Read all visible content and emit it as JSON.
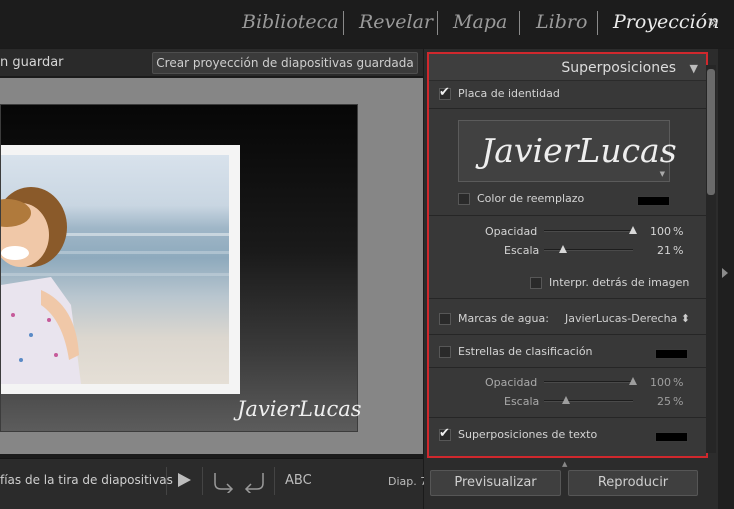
{
  "modules": {
    "items": [
      "Biblioteca",
      "Revelar",
      "Mapa",
      "Libro",
      "Proyección"
    ],
    "active": "Proyección",
    "more_glyph": "»"
  },
  "toolbar_top": {
    "unsaved_label": "n guardar",
    "create_button": "Crear proyección de diapositivas guardada"
  },
  "slide": {
    "overlay_text": "JavierLucas"
  },
  "bottom_toolbar": {
    "content_select": "fías de la tira de diapositivas ⬍",
    "abc_label": "ABC",
    "slide_count": "Diap. 7",
    "icons": [
      "play-icon",
      "rotate-left-icon",
      "rotate-right-icon"
    ]
  },
  "panel": {
    "title": "Superposiciones",
    "identity_plate": {
      "label": "Placa de identidad",
      "checked": true,
      "plate_text": "JavierLucas",
      "override_color_label": "Color de reemplazo",
      "override_color_checked": false,
      "override_color": "#000000",
      "opacity_label": "Opacidad",
      "opacity_value": "100",
      "opacity_unit": "%",
      "opacity": 1.0,
      "scale_label": "Escala",
      "scale_value": "21",
      "scale_unit": "%",
      "scale": 0.21,
      "behind_label": "Interpr. detrás de imagen",
      "behind_checked": false
    },
    "watermark": {
      "label": "Marcas de agua:",
      "checked": false,
      "value": "JavierLucas-Derecha ⬍"
    },
    "rating_stars": {
      "label": "Estrellas de clasificación",
      "checked": false,
      "color": "#000000",
      "opacity_label": "Opacidad",
      "opacity_value": "100",
      "opacity_unit": "%",
      "opacity": 1.0,
      "scale_label": "Escala",
      "scale_value": "25",
      "scale_unit": "%",
      "scale": 0.25
    },
    "text_overlays": {
      "label": "Superposiciones de texto",
      "checked": true,
      "color": "#000000"
    }
  },
  "buttons": {
    "preview": "Previsualizar",
    "play": "Reproducir"
  },
  "colors": {
    "highlight_border": "#d0282d",
    "active_module": "#ececec"
  }
}
